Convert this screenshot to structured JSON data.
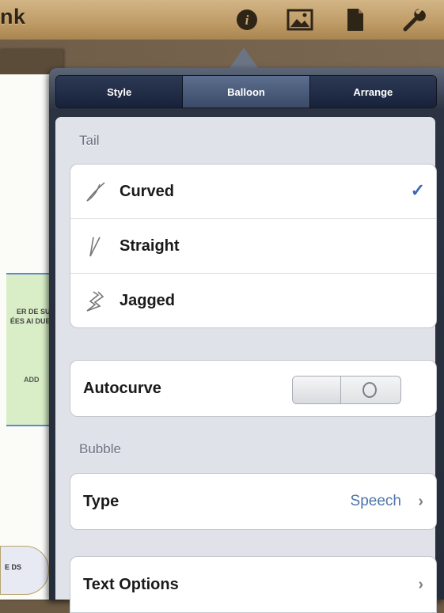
{
  "toolbar": {
    "title": "nk",
    "icons": [
      "info-icon",
      "image-icon",
      "document-icon",
      "wrench-icon"
    ]
  },
  "canvas": {
    "balloon_text": "ER DE SUR ÉES AI DUER A",
    "balloon_add": "ADD",
    "small_balloon_text": "E DS"
  },
  "popover": {
    "tabs": [
      {
        "label": "Style",
        "active": false
      },
      {
        "label": "Balloon",
        "active": true
      },
      {
        "label": "Arrange",
        "active": false
      }
    ],
    "tail": {
      "section_label": "Tail",
      "options": [
        {
          "label": "Curved",
          "selected": true
        },
        {
          "label": "Straight",
          "selected": false
        },
        {
          "label": "Jagged",
          "selected": false
        }
      ]
    },
    "autocurve": {
      "label": "Autocurve",
      "state": "off",
      "toggle_text": "O"
    },
    "bubble": {
      "section_label": "Bubble",
      "type_label": "Type",
      "type_value": "Speech"
    },
    "text_options": {
      "label": "Text Options"
    }
  },
  "colors": {
    "accent": "#3b68b4",
    "value_blue": "#4d74ad",
    "toolbar": "#c09d69",
    "panel_bg": "#dfe2e8"
  }
}
